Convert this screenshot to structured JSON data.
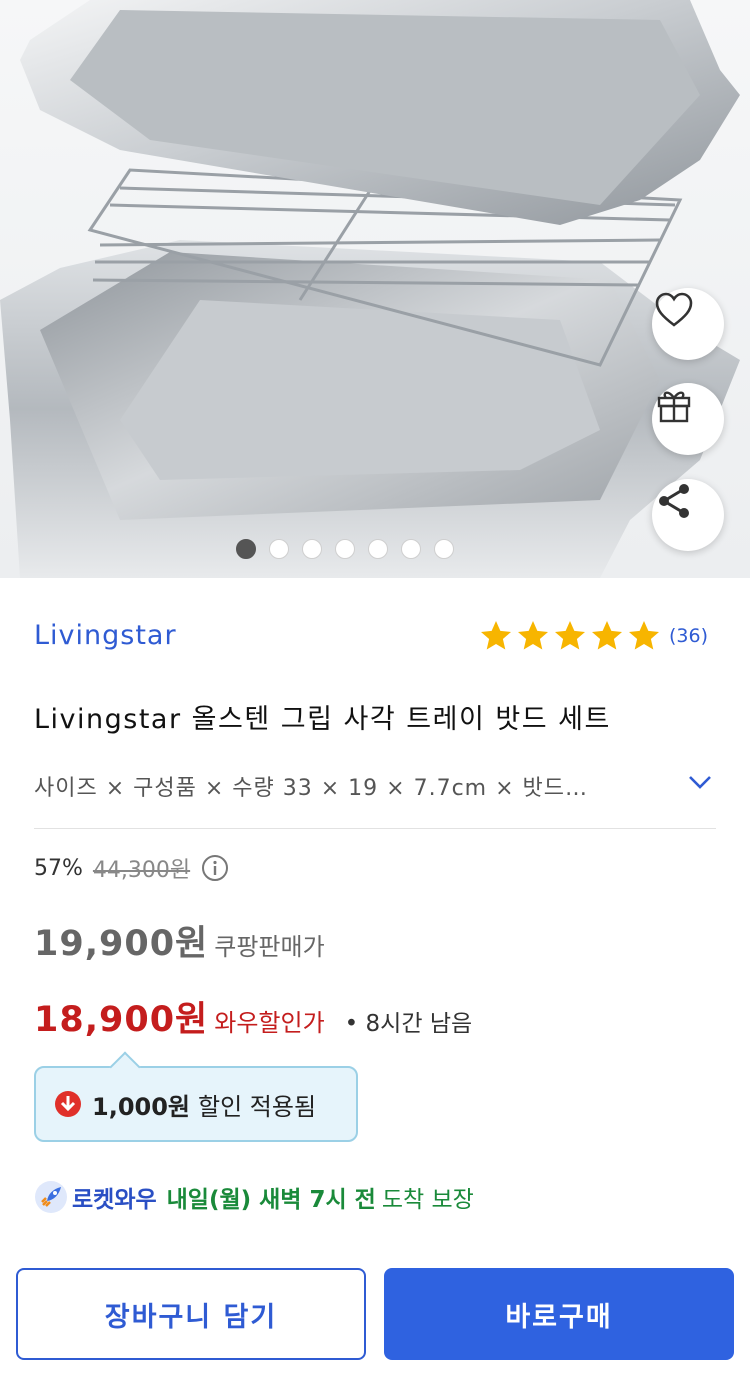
{
  "product": {
    "brand": "Livingstar",
    "title": "Livingstar 올스텐 그립 사각 트레이 밧드 세트",
    "options_text": "사이즈 × 구성품 × 수량  33 × 19 × 7.7cm × 밧드…",
    "rating": {
      "stars": 5,
      "count": "(36)"
    }
  },
  "gallery": {
    "total": 7,
    "active_index": 0
  },
  "pricing": {
    "discount_rate": "57%",
    "original_price": "44,300원",
    "price": "19,900원",
    "price_label": "쿠팡판매가",
    "wow_price": "18,900원",
    "wow_label": "와우할인가",
    "wow_remaining": "•  8시간 남음"
  },
  "coupon": {
    "amount": "1,000원",
    "text": "할인 적용됨"
  },
  "delivery": {
    "brand": "로켓와우",
    "time": "내일(월) 새벽 7시 전",
    "suffix": "도착 보장"
  },
  "actions": {
    "cart_label": "장바구니 담기",
    "buy_label": "바로구매"
  },
  "icons": {
    "wishlist": "heart-icon",
    "gift": "gift-icon",
    "share": "share-icon",
    "expand": "chevron-down-icon",
    "info": "info-icon",
    "coupon": "coupon-down-arrow-icon",
    "rocket": "rocket-icon"
  },
  "colors": {
    "brand_blue": "#2f5bd3",
    "sale_red": "#c41d1d",
    "delivery_green": "#1a8a3a",
    "star_yellow": "#f7b500"
  }
}
